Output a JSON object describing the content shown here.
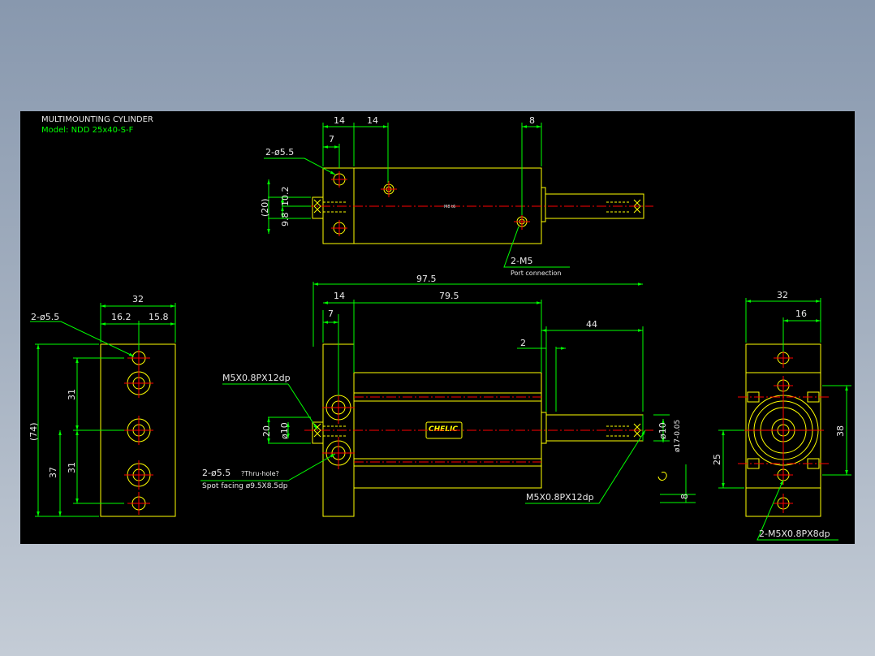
{
  "colors": {
    "part": "#ffff00",
    "dimension": "#00ff00",
    "center": "#ff0000",
    "text": "#e8e8e8",
    "title": "#00ff00"
  },
  "title": {
    "line1": "MULTIMOUNTING CYLINDER",
    "line2": "Model: NDD 25x40-S-F"
  },
  "top_view": {
    "dims": {
      "d14_a": "14",
      "d14_b": "14",
      "d7": "7",
      "d8": "8",
      "d102": "10.2",
      "d98": "9.8",
      "d20": "(20)"
    },
    "hole_label": "2-ø5.5",
    "port_label": "2-M5",
    "port_note": "Port connection",
    "center_mark": "M8 t6"
  },
  "front_view": {
    "dims": {
      "d975": "97.5",
      "d14": "14",
      "d795": "79.5",
      "d7": "7",
      "d44": "44",
      "d2": "2",
      "d20": "20",
      "d10_left": "ø10",
      "d10_right": "ø10",
      "d17": "ø17-0.05",
      "d8": "8"
    },
    "thread_left": "M5X0.8PX12dp",
    "thread_right": "M5X0.8PX12dp",
    "hole_label": "2-ø5.5",
    "hole_note": "?Thru-hole?",
    "spot_facing": "Spot facing  ø9.5X8.5dp",
    "logo": "CHELIC"
  },
  "left_view": {
    "dims": {
      "d32": "32",
      "d162": "16.2",
      "d158": "15.8",
      "d74": "(74)",
      "d31_a": "31",
      "d31_b": "31",
      "d37": "37"
    },
    "hole_label": "2-ø5.5"
  },
  "right_view": {
    "dims": {
      "d32": "32",
      "d16": "16",
      "d38": "38",
      "d25": "25"
    },
    "thread_label": "2-M5X0.8PX8dp"
  }
}
